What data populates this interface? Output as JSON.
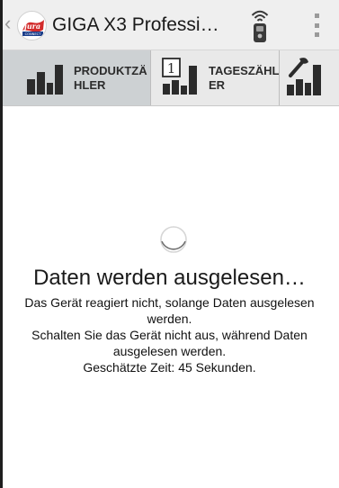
{
  "colors": {
    "action_bar_bg": "#efefef",
    "tab_bar_bg": "#e9e9e9",
    "tab_active_bg": "#cdd1d3",
    "icon_dark": "#2b2b2b",
    "logo_red": "#d22b2b",
    "text": "#1a1a1a"
  },
  "action_bar": {
    "up_glyph": "‹",
    "logo": {
      "brand_text": "jura",
      "sub_text": "CONNECT"
    },
    "title": "GIGA X3 Professi…",
    "remote_icon": "remote-wifi-icon",
    "overflow_icon": "overflow-menu-icon"
  },
  "tabs": [
    {
      "label": "PRODUKTZÄHLER",
      "icon": "bar-chart-icon",
      "active": true
    },
    {
      "label": "TAGESZÄHLER",
      "icon": "calendar-bar-chart-icon",
      "active": false
    },
    {
      "label": "",
      "icon": "wrench-bar-chart-icon",
      "active": false
    }
  ],
  "loading": {
    "title": "Daten werden ausgelesen…",
    "line1": "Das Gerät reagiert nicht, solange Daten ausgelesen werden.",
    "line2": "Schalten Sie das Gerät nicht aus, während Daten ausgelesen werden.",
    "line3": "Geschätzte Zeit: 45 Sekunden."
  }
}
